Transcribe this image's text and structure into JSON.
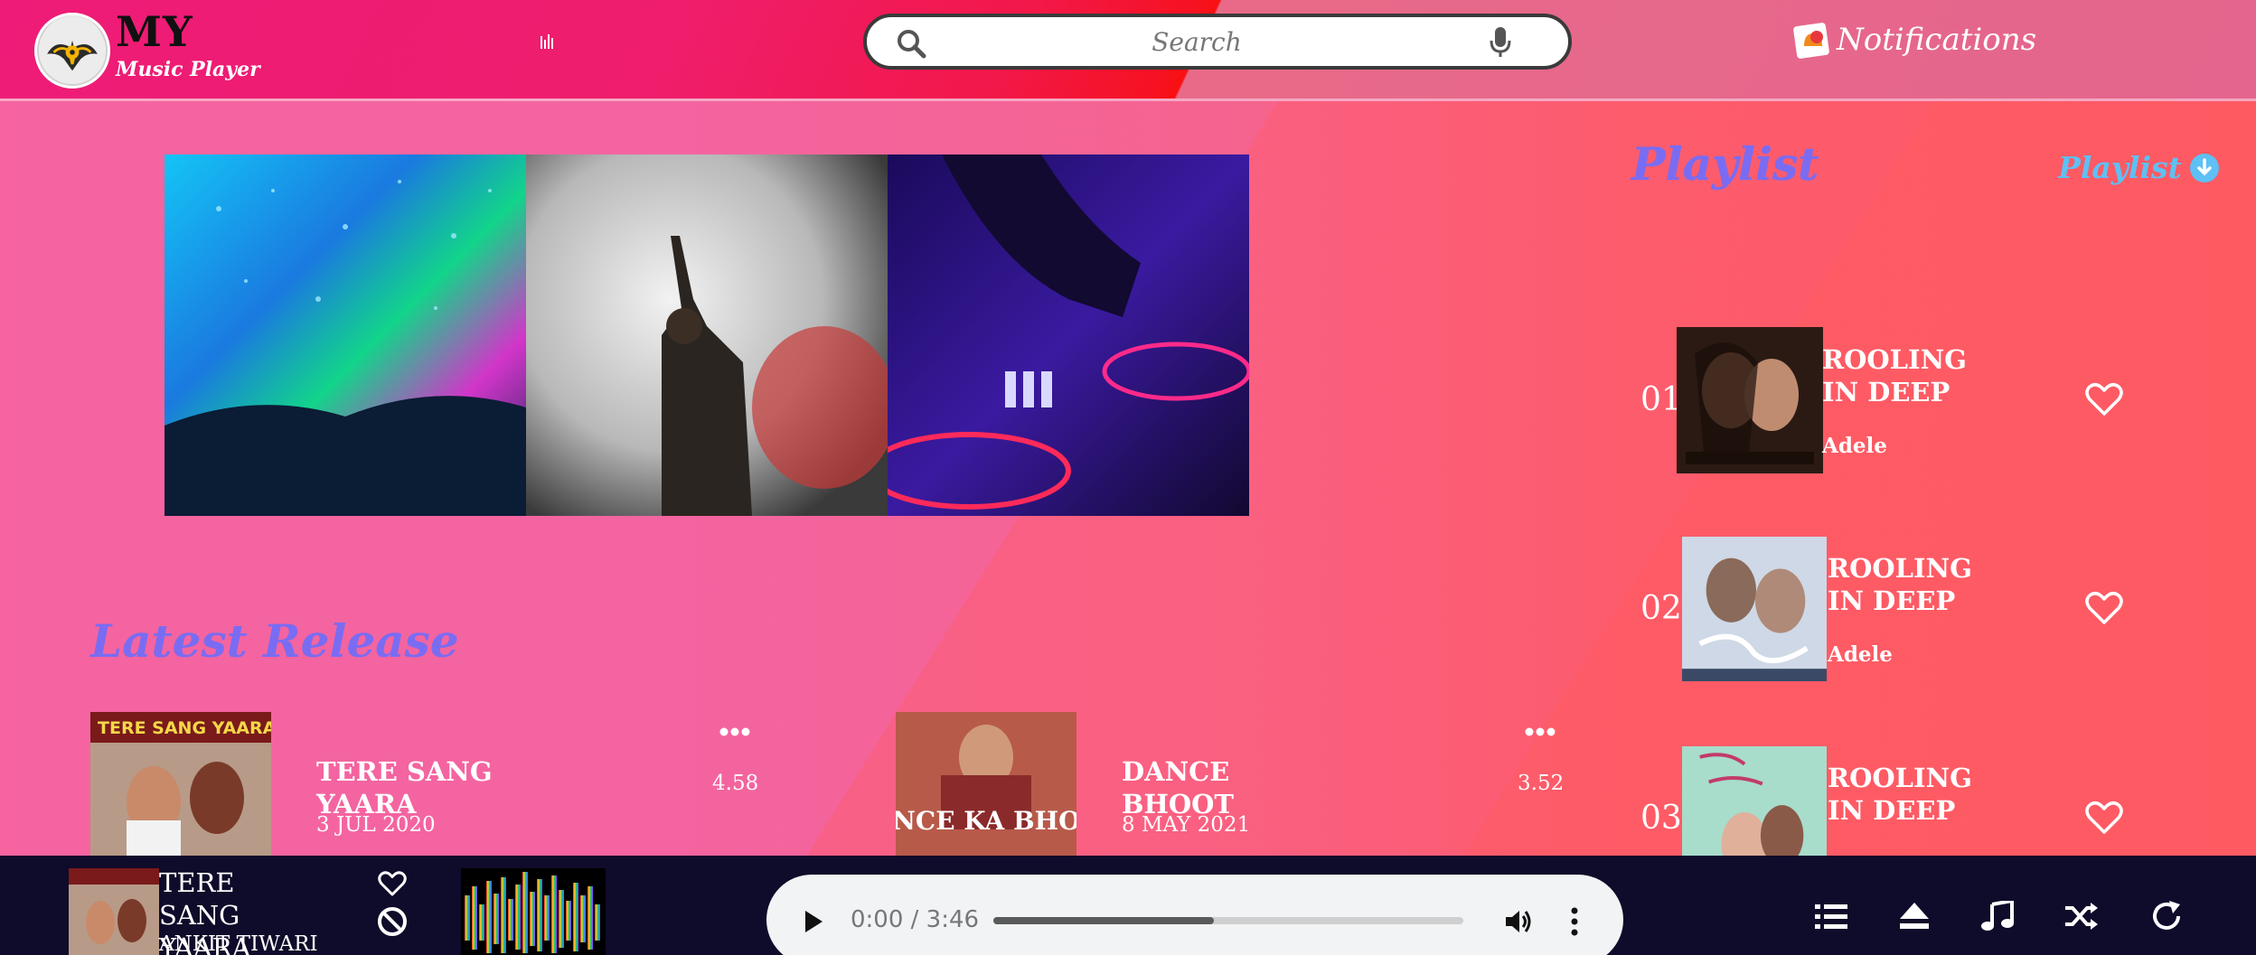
{
  "header": {
    "logo_title": "MY",
    "logo_subtitle": "Music Player",
    "search_placeholder": "Search",
    "notifications_label": "Notifications"
  },
  "playlist": {
    "title": "Playlist",
    "link_label": "Playlist",
    "items": [
      {
        "number": "01",
        "title": "ROOLING IN DEEP",
        "artist": "Adele"
      },
      {
        "number": "02",
        "title": "ROOLING IN DEEP",
        "artist": "Adele"
      },
      {
        "number": "03",
        "title": "ROOLING IN DEEP",
        "artist": ""
      }
    ]
  },
  "latest": {
    "title": "Latest Release",
    "items": [
      {
        "title": "TERE SANG YAARA",
        "date": "3 JUL 2020",
        "duration": "4.58",
        "cover_text": "TERE SANG YAARA"
      },
      {
        "title": "DANCE BHOOT",
        "date": "8 MAY 2021",
        "duration": "3.52",
        "cover_text": "DANCE KA BHOOT"
      }
    ]
  },
  "player": {
    "now_playing_title": "TERE SANG YAARA",
    "now_playing_artist": "ANKIT TIWARI",
    "time_display": "0:00 / 3:46",
    "progress_fraction": 0.47
  },
  "colors": {
    "accent_purple": "#7a6cf2",
    "accent_blue": "#5ec0f4",
    "player_bg": "#0f0b2a"
  },
  "icons": [
    "search-icon",
    "mic-icon",
    "notification-icon",
    "download-circle-icon",
    "heart-icon",
    "more-horizontal-icon",
    "play-icon",
    "volume-icon",
    "more-vertical-icon",
    "list-icon",
    "eject-icon",
    "music-note-icon",
    "shuffle-icon",
    "repeat-icon",
    "block-icon"
  ]
}
